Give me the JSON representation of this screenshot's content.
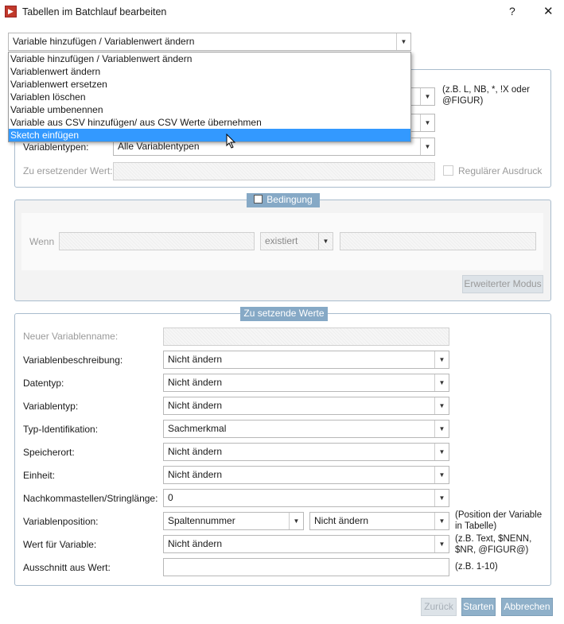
{
  "window": {
    "title": "Tabellen im Batchlauf bearbeiten",
    "help": "?",
    "close": "✕"
  },
  "mode": {
    "value": "Variable hinzufügen / Variablenwert ändern",
    "options": [
      "Variable hinzufügen / Variablenwert ändern",
      "Variablenwert ändern",
      "Variablenwert ersetzen",
      "Variablen löschen",
      "Variable umbenennen",
      "Variable aus CSV hinzufügen/ aus CSV Werte übernehmen",
      "Sketch einfügen"
    ],
    "selected_index": 6
  },
  "filter": {
    "hint": "(z.B. L, NB, *, !X oder @FIGUR)",
    "types_label": "Variablentypen:",
    "types_value": "Alle Variablentypen",
    "replace_label": "Zu ersetzender Wert:",
    "regex_label": "Regulärer Ausdruck"
  },
  "condition": {
    "title": "Bedingung",
    "if_label": "Wenn",
    "op_value": "existiert",
    "advanced": "Erweiterter Modus"
  },
  "values": {
    "title": "Zu setzende Werte",
    "rows": [
      {
        "label": "Neuer Variablenname:",
        "value": ""
      },
      {
        "label": "Variablenbeschreibung:",
        "value": "Nicht ändern"
      },
      {
        "label": "Datentyp:",
        "value": "Nicht ändern"
      },
      {
        "label": "Variablentyp:",
        "value": "Nicht ändern"
      },
      {
        "label": "Typ-Identifikation:",
        "value": "Sachmerkmal"
      },
      {
        "label": "Speicherort:",
        "value": "Nicht ändern"
      },
      {
        "label": "Einheit:",
        "value": "Nicht ändern"
      },
      {
        "label": "Nachkommastellen/Stringlänge:",
        "value": "0"
      },
      {
        "label": "Variablenposition:",
        "value": "Spaltennummer",
        "value2": "Nicht ändern",
        "hint": "(Position der Variable in Tabelle)"
      },
      {
        "label": "Wert für Variable:",
        "value": "Nicht ändern",
        "hint": "(z.B. Text, $NENN, $NR, @FIGUR@)"
      },
      {
        "label": "Ausschnitt aus Wert:",
        "value": "",
        "hint": "(z.B. 1-10)"
      }
    ]
  },
  "buttons": {
    "back": "Zurück",
    "start": "Starten",
    "cancel": "Abbrechen"
  }
}
